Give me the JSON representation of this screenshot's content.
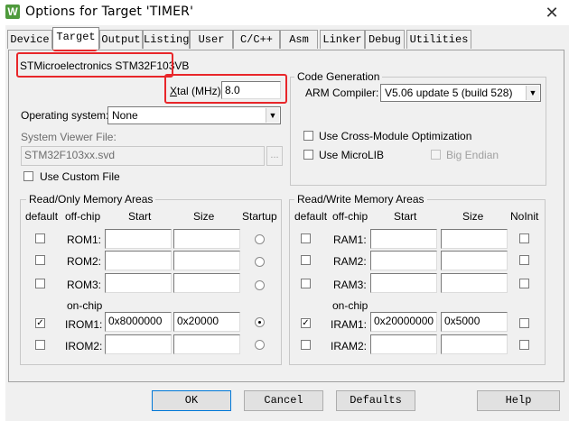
{
  "window": {
    "title": "Options for Target 'TIMER'"
  },
  "tabs": [
    {
      "label": "Device"
    },
    {
      "label": "Target"
    },
    {
      "label": "Output"
    },
    {
      "label": "Listing"
    },
    {
      "label": "User"
    },
    {
      "label": "C/C++"
    },
    {
      "label": "Asm"
    },
    {
      "label": "Linker"
    },
    {
      "label": "Debug"
    },
    {
      "label": "Utilities"
    }
  ],
  "target": {
    "device_name": "STMicroelectronics STM32F103VB",
    "xtal_label_prefix": "X",
    "xtal_label_rest": "tal (MHz):",
    "xtal_value": "8.0",
    "os_label": "Operating system:",
    "os_value": "None",
    "svf_label": "System Viewer File:",
    "svf_value": "STM32F103xx.svd",
    "svf_browse": "...",
    "custom_file_label": "Use Custom File"
  },
  "code_gen": {
    "title": "Code Generation",
    "arm_compiler_label": "ARM Compiler:",
    "arm_compiler_value": "V5.06 update 5 (build 528)",
    "cross_module_label": "Use Cross-Module Optimization",
    "microlib_label": "Use MicroLIB",
    "big_endian_label": "Big Endian"
  },
  "rom_group": {
    "title": "Read/Only Memory Areas",
    "headers": {
      "default": "default",
      "offchip": "off-chip",
      "start": "Start",
      "size": "Size",
      "startup": "Startup"
    },
    "onchip_label": "on-chip",
    "rows": [
      {
        "label": "ROM1:",
        "start": "",
        "size": ""
      },
      {
        "label": "ROM2:",
        "start": "",
        "size": ""
      },
      {
        "label": "ROM3:",
        "start": "",
        "size": ""
      },
      {
        "label": "IROM1:",
        "start": "0x8000000",
        "size": "0x20000"
      },
      {
        "label": "IROM2:",
        "start": "",
        "size": ""
      }
    ]
  },
  "ram_group": {
    "title": "Read/Write Memory Areas",
    "headers": {
      "default": "default",
      "offchip": "off-chip",
      "start": "Start",
      "size": "Size",
      "noinit": "NoInit"
    },
    "onchip_label": "on-chip",
    "rows": [
      {
        "label": "RAM1:",
        "start": "",
        "size": ""
      },
      {
        "label": "RAM2:",
        "start": "",
        "size": ""
      },
      {
        "label": "RAM3:",
        "start": "",
        "size": ""
      },
      {
        "label": "IRAM1:",
        "start": "0x20000000",
        "size": "0x5000"
      },
      {
        "label": "IRAM2:",
        "start": "",
        "size": ""
      }
    ]
  },
  "buttons": {
    "ok": "OK",
    "cancel": "Cancel",
    "defaults": "Defaults",
    "help": "Help"
  },
  "glyphs": {
    "check": "✓",
    "arrow": "▼",
    "close": "✕",
    "app_icon": "W"
  },
  "colors": {
    "highlight": "#e8262a",
    "dialog_bg": "#f0f0f0"
  }
}
